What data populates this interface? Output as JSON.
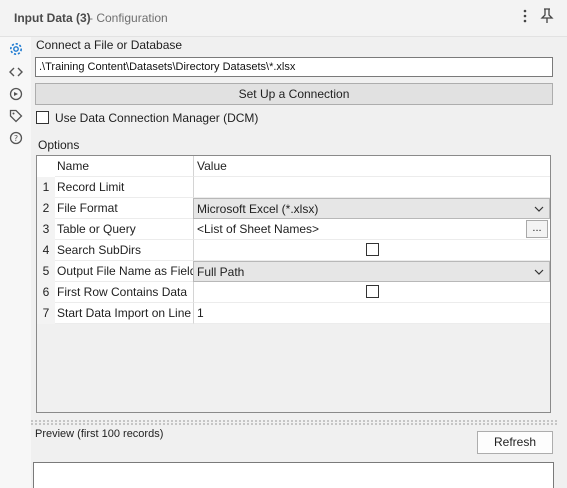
{
  "header": {
    "title": "Input Data (3)",
    "subtitle": "- Configuration"
  },
  "sidebar": {
    "icons": [
      "gear-icon",
      "code-icon",
      "plugin-icon",
      "tag-icon",
      "help-icon"
    ]
  },
  "connect": {
    "label": "Connect a File or Database",
    "path_value": ".\\Training Content\\Datasets\\Directory Datasets\\*.xlsx",
    "setup_button": "Set Up a Connection",
    "dcm_label": "Use Data Connection Manager (DCM)"
  },
  "options": {
    "label": "Options",
    "columns": [
      "Name",
      "Value"
    ],
    "rows": [
      {
        "num": "1",
        "name": "Record Limit",
        "value": ""
      },
      {
        "num": "2",
        "name": "File Format",
        "value": "Microsoft Excel (*.xlsx)"
      },
      {
        "num": "3",
        "name": "Table or Query",
        "value": "<List of Sheet Names>",
        "button": "..."
      },
      {
        "num": "4",
        "name": "Search SubDirs",
        "value": ""
      },
      {
        "num": "5",
        "name": "Output File Name as Field",
        "value": "Full Path"
      },
      {
        "num": "6",
        "name": "First Row Contains Data",
        "value": ""
      },
      {
        "num": "7",
        "name": "Start Data Import on Line",
        "value": "1"
      }
    ]
  },
  "preview": {
    "label": "Preview (first 100 records)",
    "refresh_button": "Refresh"
  },
  "colors": {
    "panel_bg": "#f0f0f0",
    "accent": "#1f7bd1"
  }
}
